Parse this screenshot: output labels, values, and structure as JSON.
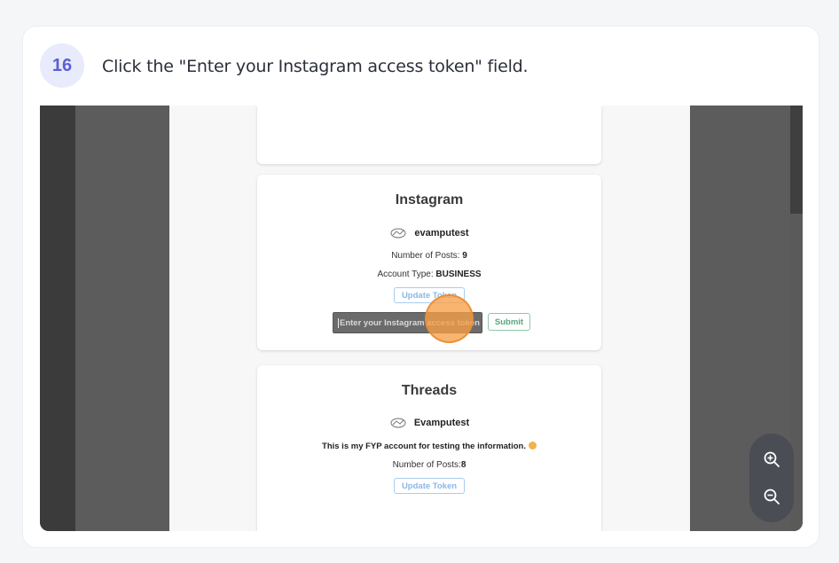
{
  "step": {
    "number": "16",
    "instruction": "Click the \"Enter your Instagram access token\" field."
  },
  "instagram": {
    "title": "Instagram",
    "username": "evamputest",
    "posts_label": "Number of Posts:",
    "posts_value": "9",
    "account_type_label": "Account Type:",
    "account_type_value": "BUSINESS",
    "update_label": "Update Token",
    "token_placeholder": "Enter your Instagram access token",
    "submit_label": "Submit"
  },
  "threads": {
    "title": "Threads",
    "username": "Evamputest",
    "bio": "This is my FYP account for testing the information.",
    "posts_label": "Number of Posts:",
    "posts_value": "8",
    "update_label": "Update Token"
  },
  "icons": {
    "avatar": "avatar-icon",
    "zoom_in": "zoom-in-icon",
    "zoom_out": "zoom-out-icon"
  },
  "colors": {
    "step_badge_bg": "#e8ebfb",
    "step_badge_text": "#5a5fd6",
    "click_marker": "#f7a048",
    "update_button": "#8ab7e8",
    "submit_button": "#5aa57f"
  }
}
